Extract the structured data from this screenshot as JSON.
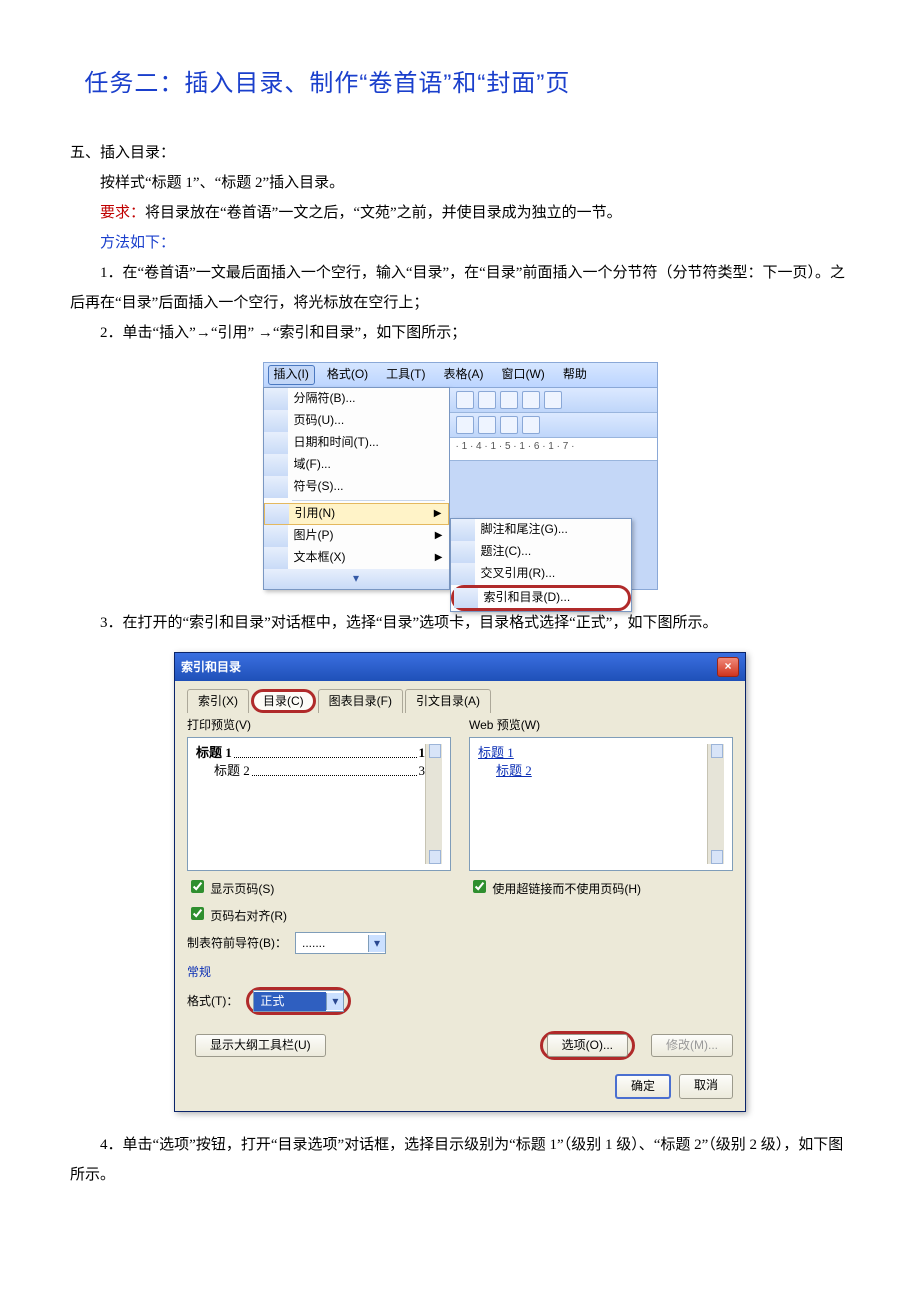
{
  "title": "任务二：插入目录、制作“卷首语”和“封面”页",
  "sectionHead": "五、插入目录：",
  "line1": "按样式“标题 1”、“标题 2”插入目录。",
  "reqLabel": "要求：",
  "reqText": "将目录放在“卷首语”一文之后，“文苑”之前，并使目录成为独立的一节。",
  "methodLabel": "方法如下：",
  "step1": "1．在“卷首语”一文最后面插入一个空行，输入“目录”，在“目录”前面插入一个分节符（分节符类型：下一页）。之后再在“目录”后面插入一个空行，将光标放在空行上；",
  "step2": "2．单击“插入”→“引用” →“索引和目录”，如下图所示；",
  "step3": "3．在打开的“索引和目录”对话框中，选择“目录”选项卡，目录格式选择“正式”，如下图所示。",
  "step4": "4．单击“选项”按钮，打开“目录选项”对话框，选择目示级别为“标题 1”（级别 1 级）、“标题 2”（级别 2 级），如下图所示。",
  "menubar": {
    "insert": "插入(I)",
    "format": "格式(O)",
    "tools": "工具(T)",
    "table": "表格(A)",
    "window": "窗口(W)",
    "help": "帮助"
  },
  "insertMenu": {
    "break": "分隔符(B)...",
    "pageNum": "页码(U)...",
    "dateTime": "日期和时间(T)...",
    "field": "域(F)...",
    "symbol": "符号(S)...",
    "reference": "引用(N)",
    "picture": "图片(P)",
    "textbox": "文本框(X)",
    "expand": "▾"
  },
  "ruler": "· 1 · 4 · 1 · 5 · 1 · 6 · 1 · 7 ·",
  "submenu": {
    "footnote": "脚注和尾注(G)...",
    "caption": "题注(C)...",
    "crossref": "交叉引用(R)...",
    "indextoc": "索引和目录(D)..."
  },
  "dlg": {
    "title": "索引和目录",
    "tabs": {
      "index": "索引(X)",
      "toc": "目录(C)",
      "fig": "图表目录(F)",
      "auth": "引文目录(A)"
    },
    "printPreview": "打印预览(V)",
    "webPreview": "Web 预览(W)",
    "pv": {
      "h1": "标题 1",
      "h1page": "1",
      "h2": "标题 2",
      "h2page": "3"
    },
    "webpv": {
      "h1": "标题 1",
      "h2": "标题 2"
    },
    "showPage": "显示页码(S)",
    "rightAlign": "页码右对齐(R)",
    "useHyperlink": "使用超链接而不使用页码(H)",
    "leader": "制表符前导符(B)：",
    "leaderVal": ".......",
    "general": "常规",
    "format": "格式(T)：",
    "formatVal": "正式",
    "showOutline": "显示大纲工具栏(U)",
    "options": "选项(O)...",
    "modify": "修改(M)...",
    "ok": "确定",
    "cancel": "取消"
  }
}
